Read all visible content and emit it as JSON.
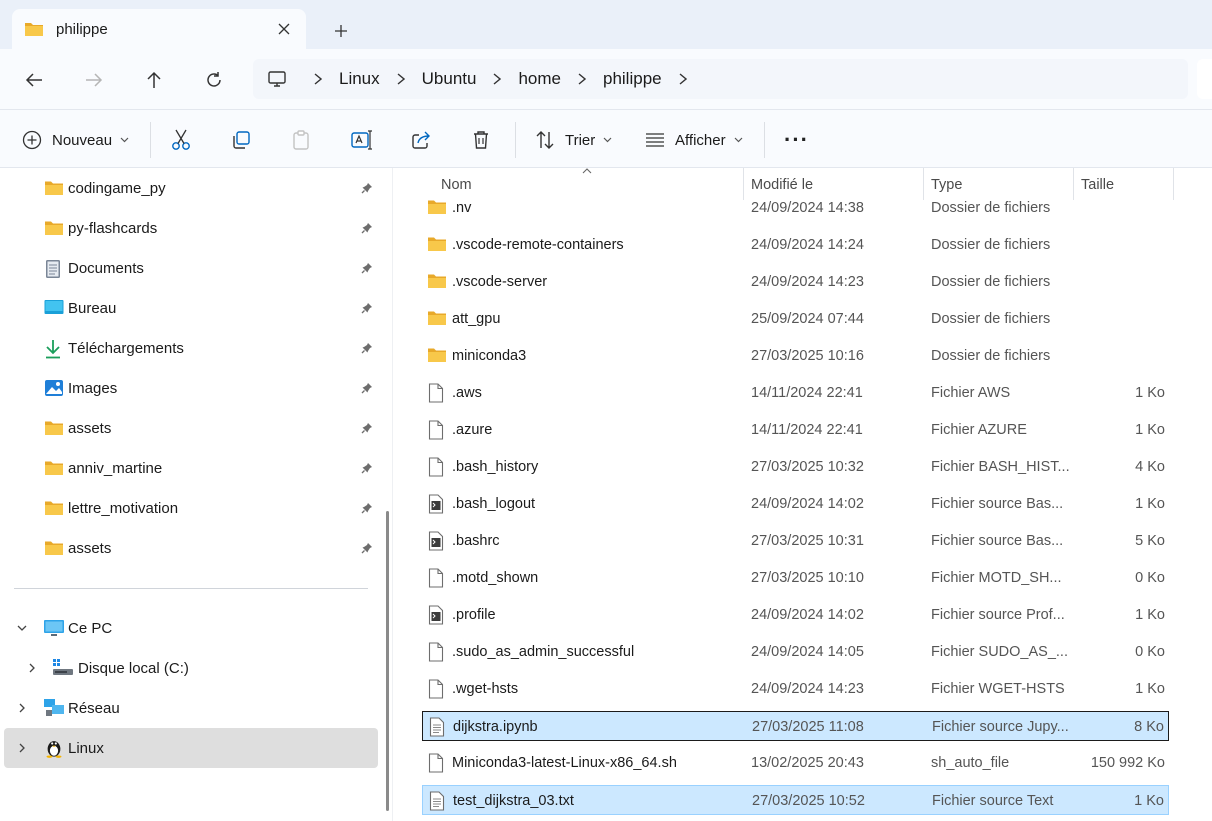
{
  "tab": {
    "title": "philippe"
  },
  "breadcrumb": [
    "Linux",
    "Ubuntu",
    "home",
    "philippe"
  ],
  "toolbar": {
    "new_label": "Nouveau",
    "sort_label": "Trier",
    "view_label": "Afficher",
    "more_label": "···"
  },
  "sidebar": {
    "pinned": [
      {
        "label": "codingame_py",
        "icon": "folder-icon"
      },
      {
        "label": "py-flashcards",
        "icon": "folder-icon"
      },
      {
        "label": "Documents",
        "icon": "documents-icon"
      },
      {
        "label": "Bureau",
        "icon": "desktop-icon"
      },
      {
        "label": "Téléchargements",
        "icon": "download-icon"
      },
      {
        "label": "Images",
        "icon": "images-icon"
      },
      {
        "label": "assets",
        "icon": "folder-icon"
      },
      {
        "label": "anniv_martine",
        "icon": "folder-icon"
      },
      {
        "label": "lettre_motivation",
        "icon": "folder-icon"
      },
      {
        "label": "assets",
        "icon": "folder-icon"
      }
    ],
    "tree": {
      "this_pc": "Ce PC",
      "local_disk": "Disque local (C:)",
      "network": "Réseau",
      "linux": "Linux"
    }
  },
  "columns": {
    "name": "Nom",
    "modified": "Modifié le",
    "type": "Type",
    "size": "Taille"
  },
  "files": [
    {
      "name": ".nv",
      "modified": "24/09/2024 14:38",
      "type": "Dossier de fichiers",
      "size": "",
      "icon": "folder-icon"
    },
    {
      "name": ".vscode-remote-containers",
      "modified": "24/09/2024 14:24",
      "type": "Dossier de fichiers",
      "size": "",
      "icon": "folder-icon"
    },
    {
      "name": ".vscode-server",
      "modified": "24/09/2024 14:23",
      "type": "Dossier de fichiers",
      "size": "",
      "icon": "folder-icon"
    },
    {
      "name": "att_gpu",
      "modified": "25/09/2024 07:44",
      "type": "Dossier de fichiers",
      "size": "",
      "icon": "folder-icon"
    },
    {
      "name": "miniconda3",
      "modified": "27/03/2025 10:16",
      "type": "Dossier de fichiers",
      "size": "",
      "icon": "folder-icon"
    },
    {
      "name": ".aws",
      "modified": "14/11/2024 22:41",
      "type": "Fichier AWS",
      "size": "1 Ko",
      "icon": "file-icon"
    },
    {
      "name": ".azure",
      "modified": "14/11/2024 22:41",
      "type": "Fichier AZURE",
      "size": "1 Ko",
      "icon": "file-icon"
    },
    {
      "name": ".bash_history",
      "modified": "27/03/2025 10:32",
      "type": "Fichier BASH_HIST...",
      "size": "4 Ko",
      "icon": "file-icon"
    },
    {
      "name": ".bash_logout",
      "modified": "24/09/2024 14:02",
      "type": "Fichier source Bas...",
      "size": "1 Ko",
      "icon": "script-file-icon"
    },
    {
      "name": ".bashrc",
      "modified": "27/03/2025 10:31",
      "type": "Fichier source Bas...",
      "size": "5 Ko",
      "icon": "script-file-icon"
    },
    {
      "name": ".motd_shown",
      "modified": "27/03/2025 10:10",
      "type": "Fichier MOTD_SH...",
      "size": "0 Ko",
      "icon": "file-icon"
    },
    {
      "name": ".profile",
      "modified": "24/09/2024 14:02",
      "type": "Fichier source Prof...",
      "size": "1 Ko",
      "icon": "script-file-icon"
    },
    {
      "name": ".sudo_as_admin_successful",
      "modified": "24/09/2024 14:05",
      "type": "Fichier SUDO_AS_...",
      "size": "0 Ko",
      "icon": "file-icon"
    },
    {
      "name": ".wget-hsts",
      "modified": "24/09/2024 14:23",
      "type": "Fichier WGET-HSTS",
      "size": "1 Ko",
      "icon": "file-icon"
    },
    {
      "name": "dijkstra.ipynb",
      "modified": "27/03/2025 11:08",
      "type": "Fichier source Jupy...",
      "size": "8 Ko",
      "icon": "text-file-icon",
      "selected": true,
      "focused": true
    },
    {
      "name": "Miniconda3-latest-Linux-x86_64.sh",
      "modified": "13/02/2025 20:43",
      "type": "sh_auto_file",
      "size": "150 992 Ko",
      "icon": "file-icon"
    },
    {
      "name": "test_dijkstra_03.txt",
      "modified": "27/03/2025 10:52",
      "type": "Fichier source Text",
      "size": "1 Ko",
      "icon": "text-file-icon",
      "selected": true
    }
  ],
  "colors": {
    "folder": "#f8c84a",
    "folder_dark": "#e8a92a",
    "selection": "#cce8ff",
    "selection_border": "#99d1ff",
    "accent": "#0067c0"
  }
}
